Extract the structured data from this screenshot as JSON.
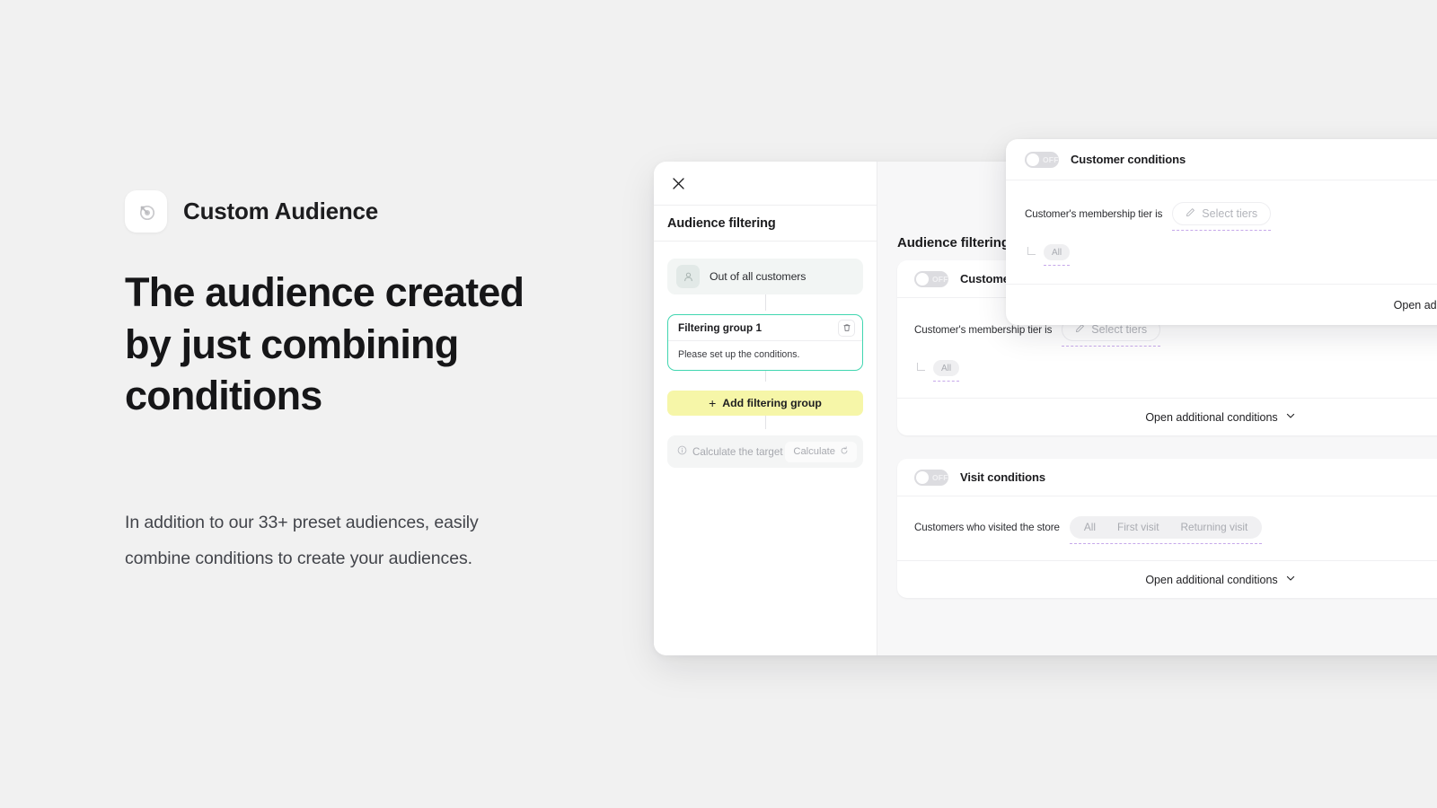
{
  "hero": {
    "icon": "target-arrow-icon",
    "eyebrow": "Custom Audience",
    "title": "The audience created by just combining conditions",
    "body": "In addition to our 33+ preset audiences, easily combine conditions to create your audiences."
  },
  "app": {
    "left_pane": {
      "close_icon": "close-icon",
      "heading": "Audience filtering",
      "all_customers": {
        "icon": "person-icon",
        "label": "Out of all customers"
      },
      "filtering_group": {
        "title": "Filtering group 1",
        "delete_icon": "trash-icon",
        "empty_message": "Please set up the conditions."
      },
      "add_group_button": {
        "plus": "+",
        "label": "Add filtering group"
      },
      "calculate_row": {
        "info_icon": "info-circle-icon",
        "label": "Calculate the target",
        "button_label": "Calculate",
        "button_icon": "refresh-icon"
      }
    },
    "right_pane": {
      "heading": "Audience filtering C",
      "cards": [
        {
          "toggle_state": "OFF",
          "title": "Customer conditions",
          "row_label": "Customer's membership tier is",
          "control_type": "pill-select",
          "control_icon": "pencil-icon",
          "control_label": "Select tiers",
          "sub_chip": "All",
          "footer_label": "Open additional conditions",
          "footer_icon": "chevron-down-icon"
        },
        {
          "toggle_state": "OFF",
          "title": "Visit conditions",
          "row_label": "Customers who visited the store",
          "control_type": "segmented",
          "segments": [
            "All",
            "First visit",
            "Returning visit"
          ],
          "footer_label": "Open additional conditions",
          "footer_icon": "chevron-down-icon"
        }
      ]
    },
    "overlay_card": {
      "toggle_state": "OFF",
      "title": "Customer conditions",
      "row_label": "Customer's membership tier is",
      "control_icon": "pencil-icon",
      "control_label": "Select tiers",
      "sub_chip": "All",
      "footer_label": "Open additional conditions"
    }
  },
  "colors": {
    "page_bg": "#f1f1f1",
    "accent_green": "#41d6b0",
    "accent_yellow": "#f6f6a8",
    "dashed_purple": "#c6a8ea",
    "text_primary": "#161618",
    "text_muted": "#a9abb1"
  }
}
